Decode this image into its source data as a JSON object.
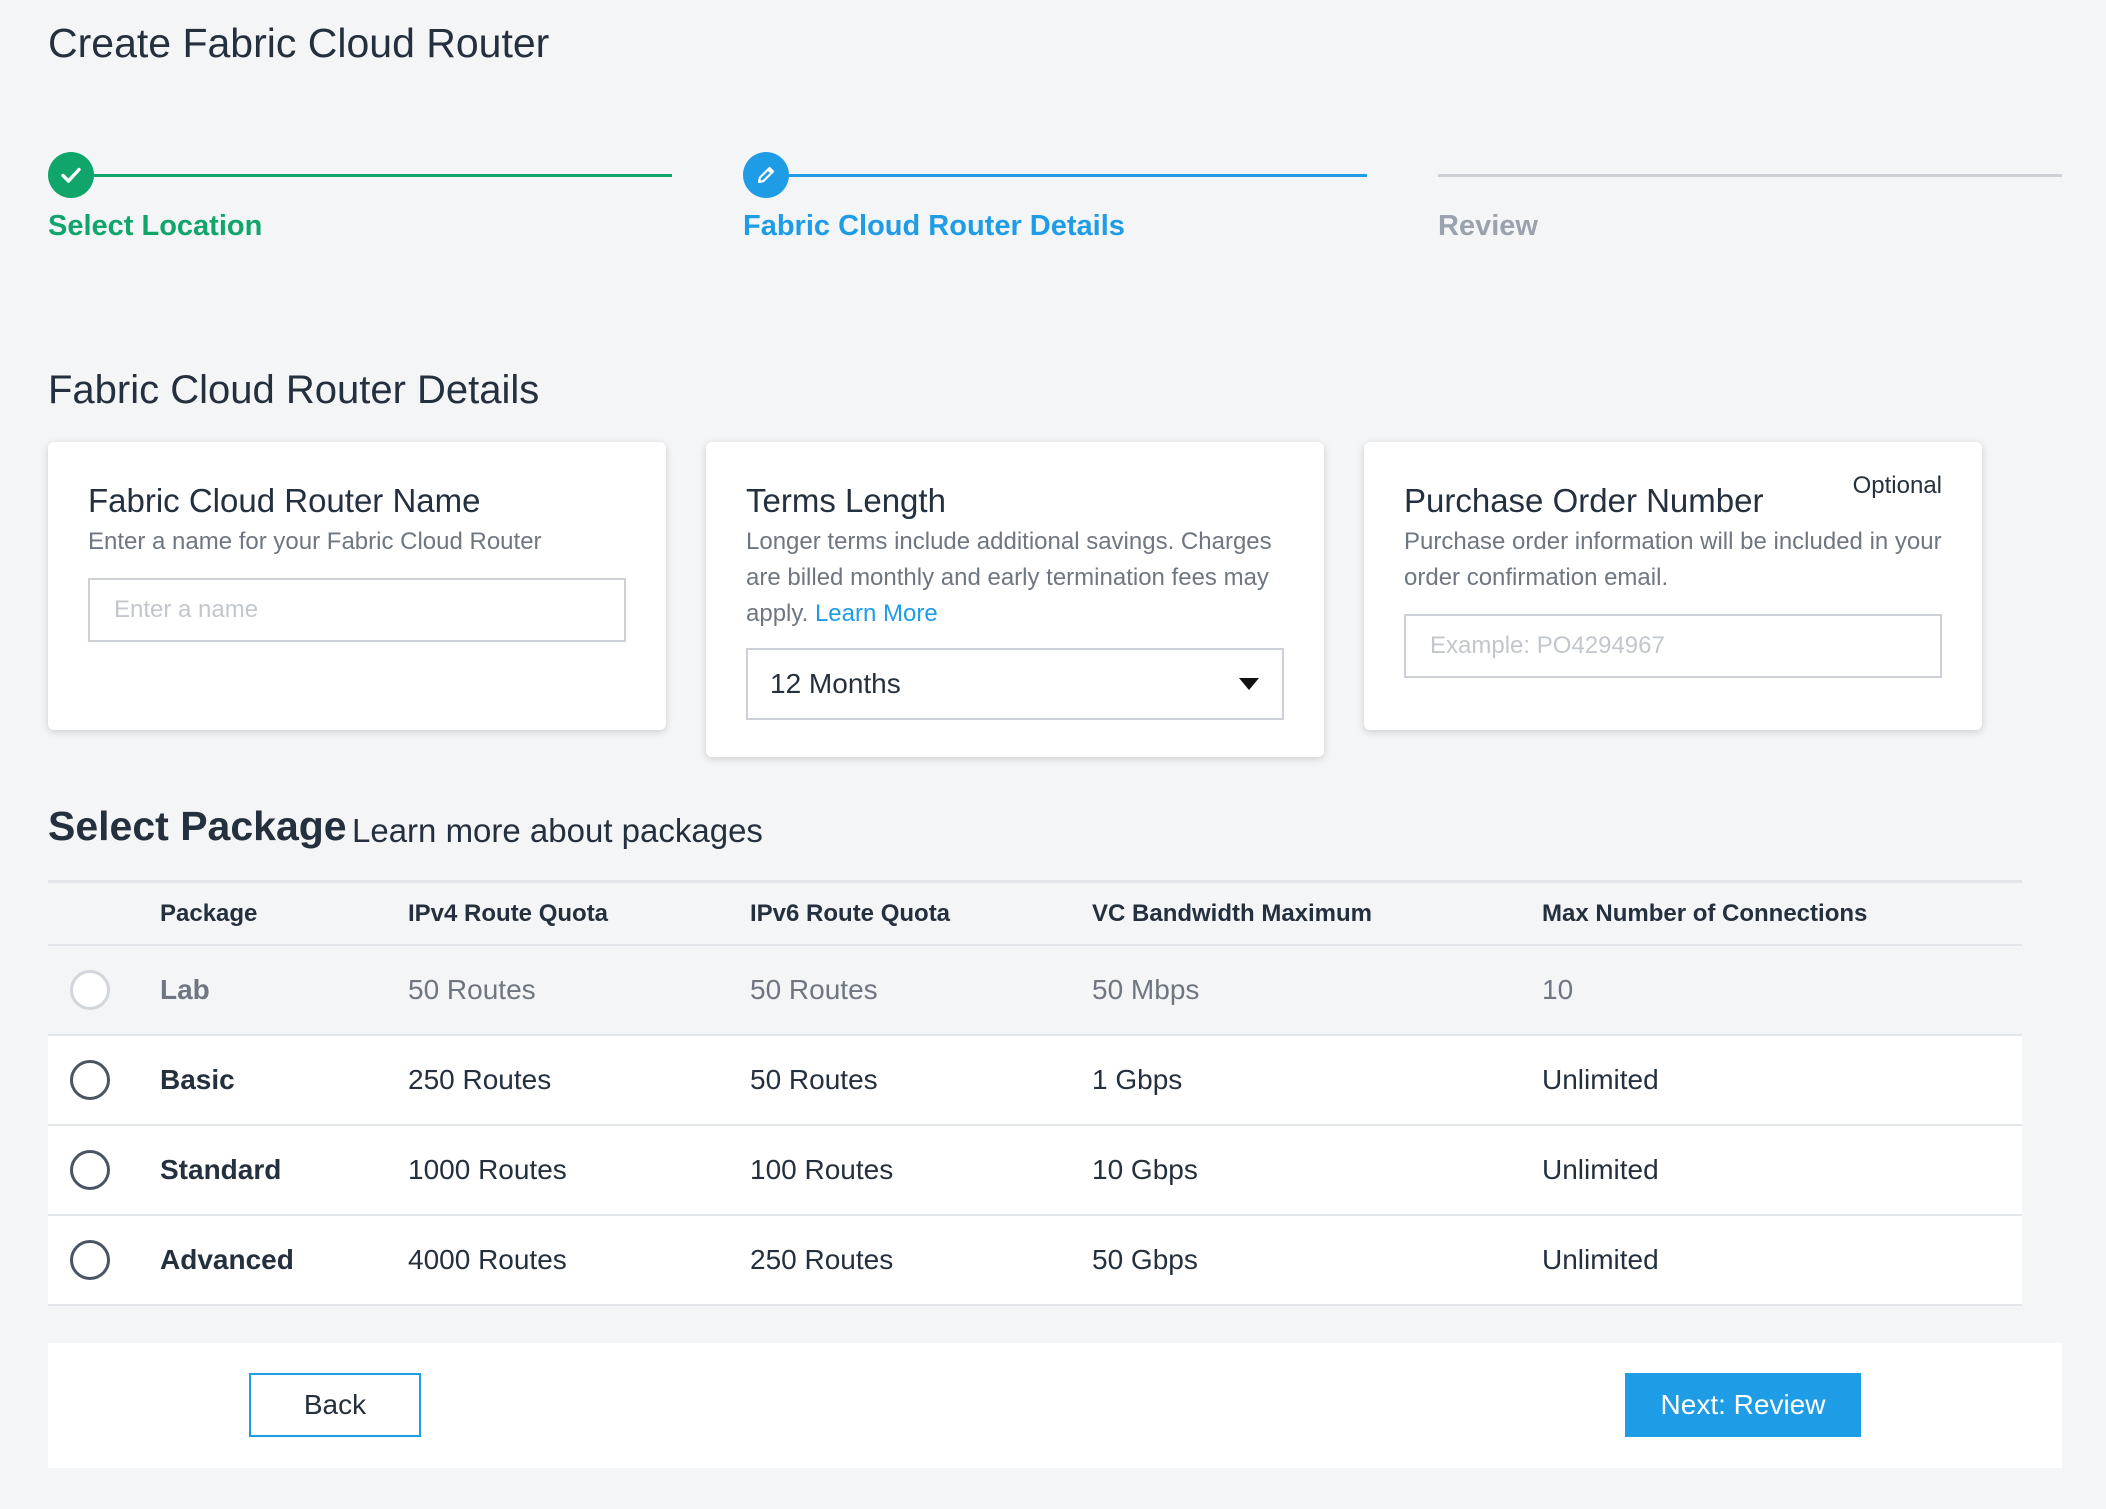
{
  "page_title": "Create Fabric Cloud Router",
  "stepper": {
    "steps": [
      {
        "label": "Select Location",
        "state": "complete",
        "icon": "check-icon"
      },
      {
        "label": "Fabric Cloud Router Details",
        "state": "active",
        "icon": "pencil-icon"
      },
      {
        "label": "Review",
        "state": "pending"
      }
    ],
    "colors": {
      "complete": "#10a56b",
      "active": "#1e9ce6",
      "pending": "#cdd1d7"
    }
  },
  "details": {
    "title": "Fabric Cloud Router Details",
    "name_card": {
      "title": "Fabric Cloud Router Name",
      "description": "Enter a name for your Fabric Cloud Router",
      "placeholder": "Enter a name",
      "value": ""
    },
    "terms_card": {
      "title": "Terms Length",
      "description": "Longer terms include additional savings. Charges are billed monthly and early termination fees may apply.",
      "link": "Learn More",
      "selected": "12 Months"
    },
    "po_card": {
      "title": "Purchase Order Number",
      "optional": "Optional",
      "description": "Purchase order information will be included in your order confirmation email.",
      "placeholder": "Example: PO4294967",
      "value": ""
    }
  },
  "packages": {
    "title": "Select Package",
    "link": "Learn more about packages",
    "columns": [
      "Package",
      "IPv4 Route Quota",
      "IPv6 Route Quota",
      "VC Bandwidth Maximum",
      "Max Number of Connections"
    ],
    "rows": [
      {
        "name": "Lab",
        "ipv4": "50 Routes",
        "ipv6": "50 Routes",
        "bandwidth": "50 Mbps",
        "max": "10",
        "disabled": true
      },
      {
        "name": "Basic",
        "ipv4": "250 Routes",
        "ipv6": "50 Routes",
        "bandwidth": "1 Gbps",
        "max": "Unlimited",
        "disabled": false
      },
      {
        "name": "Standard",
        "ipv4": "1000 Routes",
        "ipv6": "100 Routes",
        "bandwidth": "10 Gbps",
        "max": "Unlimited",
        "disabled": false
      },
      {
        "name": "Advanced",
        "ipv4": "4000 Routes",
        "ipv6": "250 Routes",
        "bandwidth": "50 Gbps",
        "max": "Unlimited",
        "disabled": false
      }
    ]
  },
  "actions": {
    "back": "Back",
    "next": "Next: Review",
    "accent": "#1e9ce6"
  }
}
